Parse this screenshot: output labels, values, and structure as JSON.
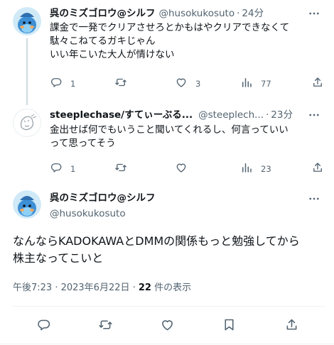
{
  "colors": {
    "text": "#0f1419",
    "secondary": "#536471",
    "divider": "#eff3f4",
    "thread_line": "#cfd9de"
  },
  "reply1": {
    "name": "呉のミズゴロウ@シルフ",
    "handle": "@husokukosuto",
    "time": "24分",
    "lines": [
      "課金で一発でクリアさせろとかもはやクリアできなくて",
      "駄々こねてるガキじゃん",
      "いい年こいた大人が情けない"
    ],
    "reply_count": "1",
    "retweet_count": "",
    "like_count": "3",
    "view_count": "77"
  },
  "reply2": {
    "name": "steeplechase/すてぃーぶる...",
    "handle": "@steeplech...",
    "time": "23分",
    "lines": [
      "金出せば何でもいうこと聞いてくれるし、何言っていい",
      "って思ってそう"
    ],
    "reply_count": "1",
    "retweet_count": "",
    "like_count": "",
    "view_count": "23"
  },
  "main": {
    "name": "呉のミズゴロウ@シルフ",
    "handle": "@husokukosuto",
    "lines": [
      "なんならKADOKAWAとDMMの関係もっと勉強してから",
      "株主なってこいと"
    ],
    "time_date": "午後7:23 · 2023年6月22日 · ",
    "views_count": "22",
    "views_label": " 件の表示"
  },
  "icons": [
    "more-icon",
    "reply-icon",
    "retweet-icon",
    "like-icon",
    "views-icon",
    "share-icon",
    "bookmark-icon"
  ]
}
